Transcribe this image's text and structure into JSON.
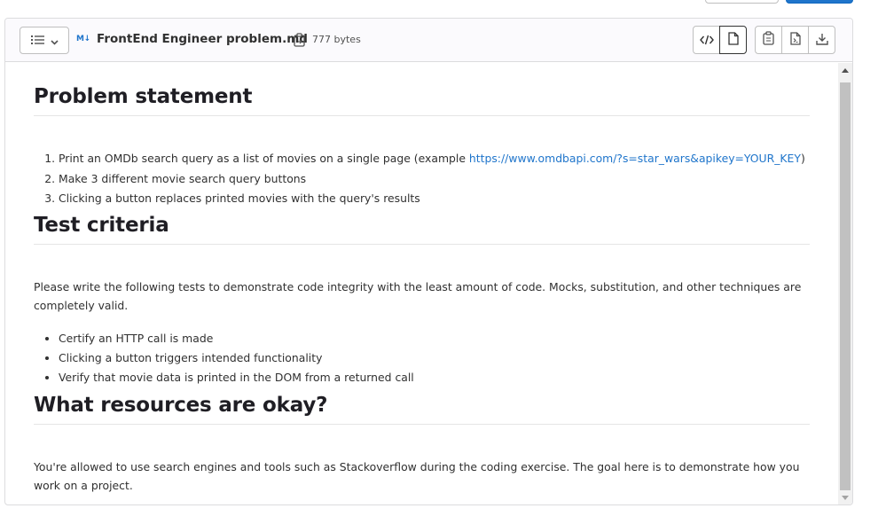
{
  "file": {
    "icon_label": "M↓",
    "title": "FrontEnd Engineer problem.md",
    "size": "777 bytes"
  },
  "icons": {
    "tree_toggle": "list-icon",
    "chevron": "chevron-down-icon",
    "copy_path": "copy-to-clipboard-icon",
    "source_view": "code-icon",
    "rich_view": "document-icon",
    "copy_contents": "copy-contents-icon",
    "open_raw": "file-code-icon",
    "download": "download-icon"
  },
  "colors": {
    "link": "#1f75cb",
    "primary_button": "#1f75cb",
    "header_bg": "#fbfafd"
  },
  "markdown": {
    "problem_heading": "Problem statement",
    "problem_items": [
      "Print an OMDb search query as a list of movies on a single page (example ",
      "Make 3 different movie search query buttons",
      "Clicking a button replaces printed movies with the query's results"
    ],
    "problem_link": "https://www.omdbapi.com/?s=star_wars&apikey=YOUR_KEY",
    "problem_item1_suffix": ")",
    "test_heading": "Test criteria",
    "test_paragraph": "Please write the following tests to demonstrate code integrity with the least amount of code. Mocks, substitution, and other techniques are completely valid.",
    "test_items": [
      "Certify an HTTP call is made",
      "Clicking a button triggers intended functionality",
      "Verify that movie data is printed in the DOM from a returned call"
    ],
    "resources_heading": "What resources are okay?",
    "resources_paragraph": "You're allowed to use search engines and tools such as Stackoverflow during the coding exercise. The goal here is to demonstrate how you work on a project."
  }
}
